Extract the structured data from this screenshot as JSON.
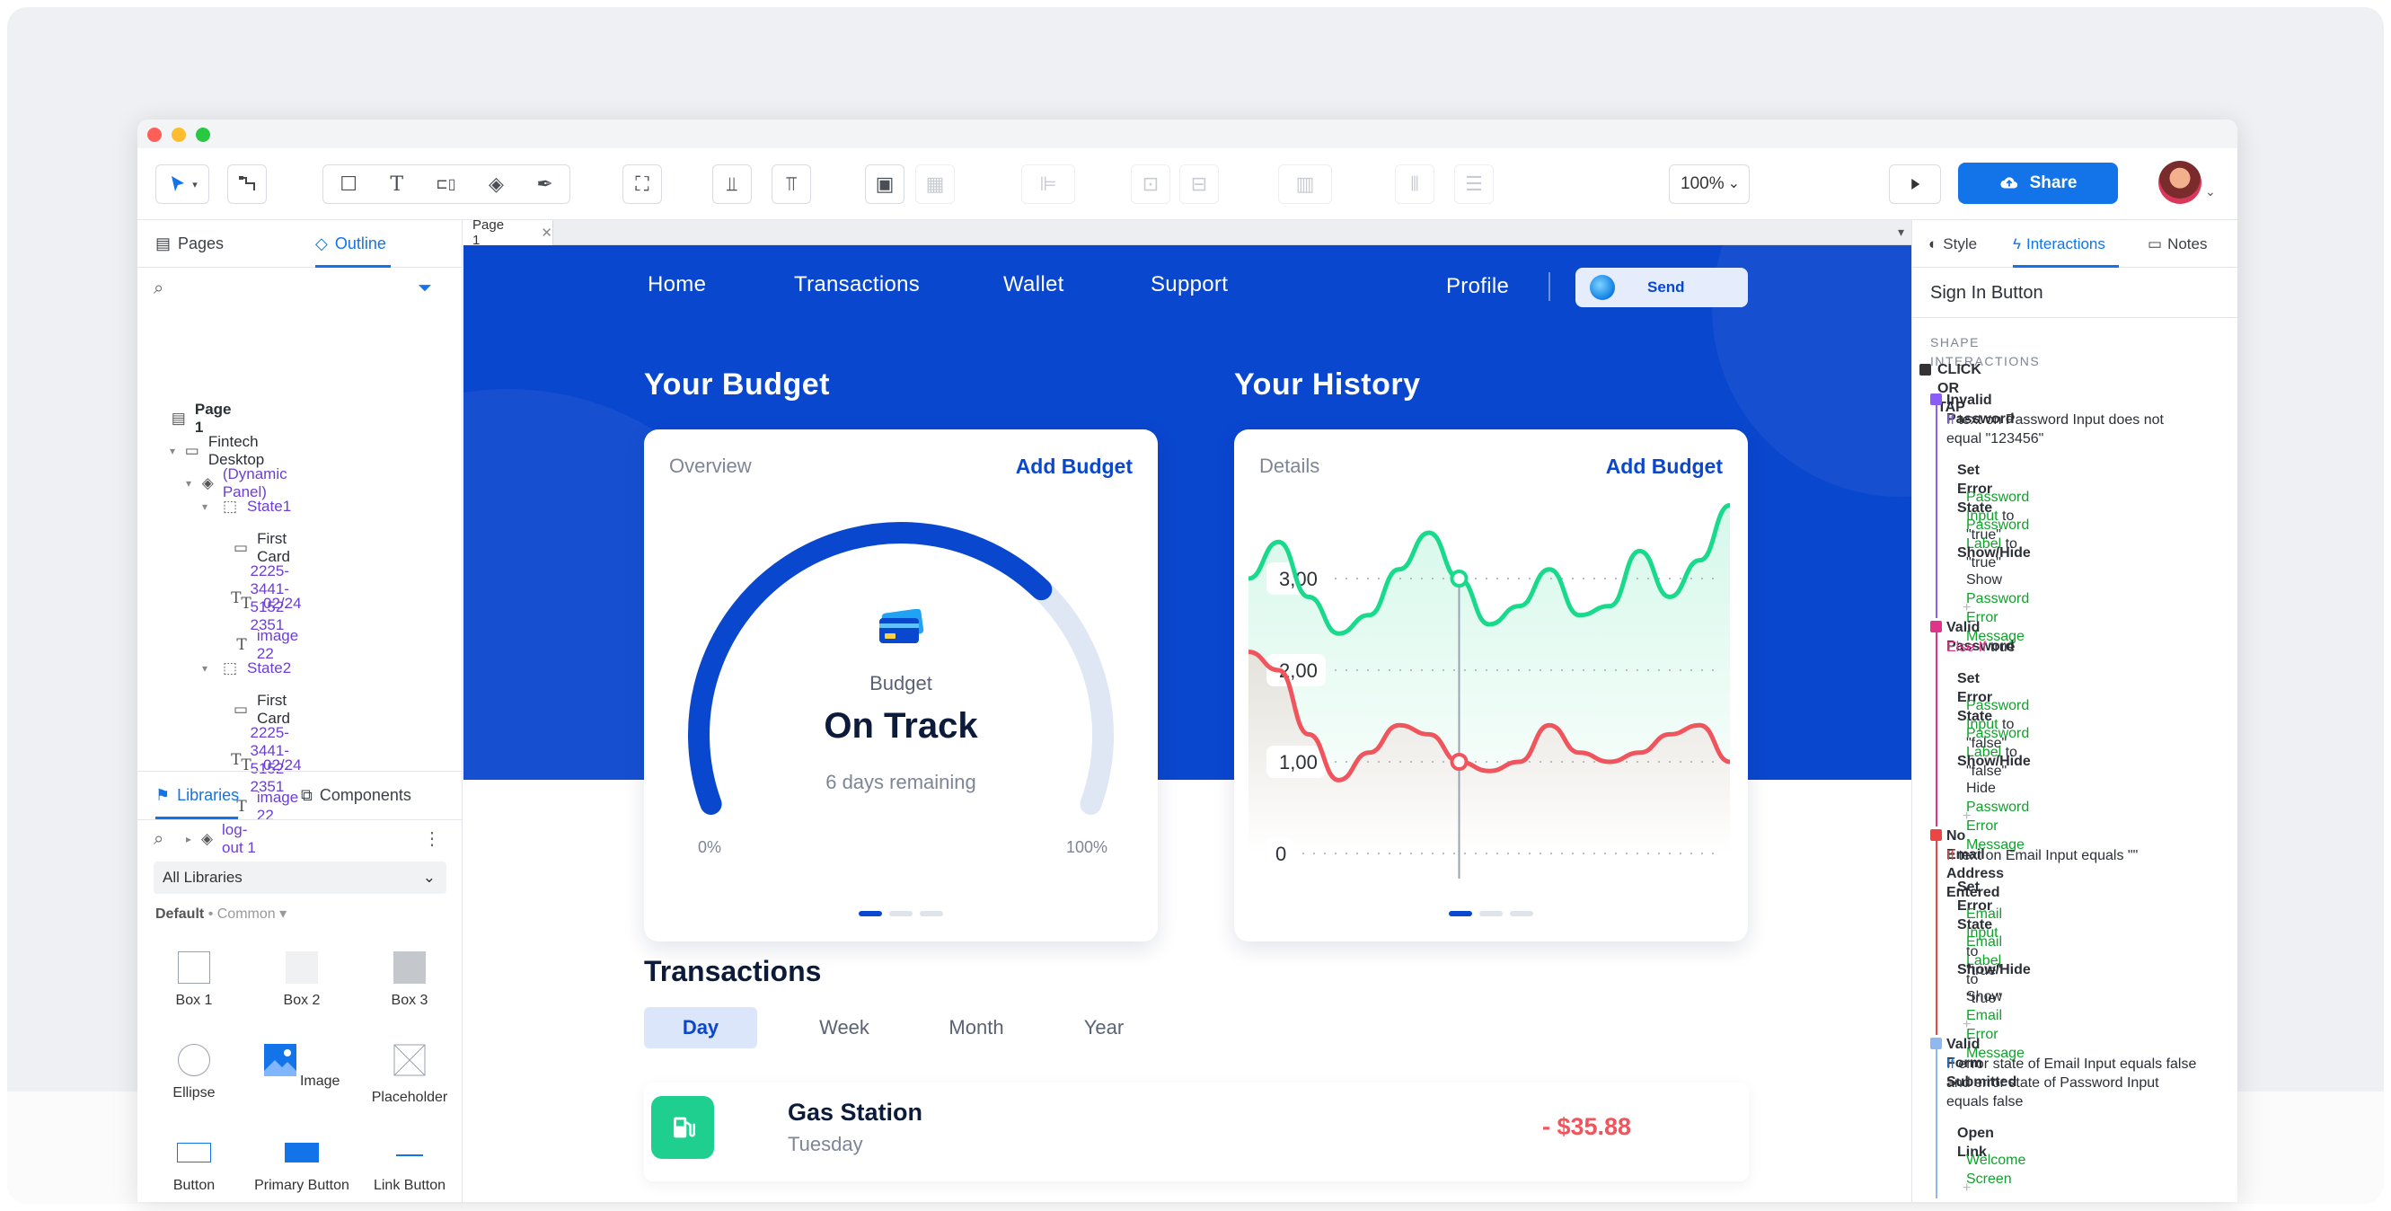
{
  "toolbar": {
    "zoom": "100%",
    "share_label": "Share"
  },
  "left_panel": {
    "tabs": [
      "Pages",
      "Outline"
    ],
    "tree": [
      {
        "label": "Page 1",
        "level": 0,
        "icon": "page-icon"
      },
      {
        "label": "Fintech Desktop",
        "level": 1,
        "icon": "folder-icon"
      },
      {
        "label": "(Dynamic Panel)",
        "level": 2,
        "icon": "layers-icon"
      },
      {
        "label": "State1",
        "level": 3,
        "icon": "state-icon"
      },
      {
        "label": "First Card",
        "level": 4,
        "icon": "rectangle-icon"
      },
      {
        "label": "2225-3441-5152-2351",
        "level": 4,
        "icon": "text-icon"
      },
      {
        "label": "02/24",
        "level": 4,
        "icon": "text-icon"
      },
      {
        "label": "image 22",
        "level": 4,
        "icon": "text-icon"
      },
      {
        "label": "State2",
        "level": 3,
        "icon": "state-icon"
      },
      {
        "label": "First Card",
        "level": 4,
        "icon": "rectangle-icon"
      },
      {
        "label": "2225-3441-5152-2351",
        "level": 4,
        "icon": "text-icon"
      },
      {
        "label": "02/24",
        "level": 4,
        "icon": "text-icon"
      },
      {
        "label": "image 22",
        "level": 4,
        "icon": "text-icon"
      },
      {
        "label": "log-out 1",
        "level": 2,
        "icon": "layers-icon"
      }
    ],
    "library_tabs": [
      "Libraries",
      "Components"
    ],
    "library_select": "All Libraries",
    "default_label": "Default",
    "common_label": "Common",
    "shapes": [
      "Box 1",
      "Box 2",
      "Box 3",
      "Ellipse",
      "Image",
      "Placeholder",
      "Button",
      "Primary Button",
      "Link Button"
    ]
  },
  "canvas": {
    "page_tab": "Page 1",
    "nav": [
      "Home",
      "Transactions",
      "Wallet",
      "Support",
      "Profile"
    ],
    "send_label": "Send",
    "budget": {
      "title": "Your Budget",
      "label": "Overview",
      "action": "Add Budget",
      "caption": "Budget",
      "status": "On Track",
      "remaining": "6 days remaining",
      "min": "0%",
      "max": "100%"
    },
    "history": {
      "title": "Your History",
      "label": "Details",
      "action": "Add Budget"
    },
    "transactions": {
      "title": "Transactions",
      "tabs": [
        "Day",
        "Week",
        "Month",
        "Year"
      ],
      "row": {
        "name": "Gas Station",
        "day": "Tuesday",
        "amount": "- $35.88"
      }
    }
  },
  "chart_data": [
    {
      "type": "gauge",
      "value": 0.7,
      "range_labels": [
        "0%",
        "100%"
      ]
    },
    {
      "type": "line",
      "yticks": [
        "0",
        "1,00",
        "2,00",
        "3,00"
      ],
      "ylim": [
        0,
        3.5
      ],
      "series": [
        {
          "color": "#19d98b",
          "values": [
            3.0,
            3.4,
            2.8,
            2.4,
            2.6,
            3.1,
            3.5,
            3.0,
            2.5,
            2.7,
            3.1,
            2.6,
            2.7,
            3.3,
            2.8,
            3.2,
            3.8
          ]
        },
        {
          "color": "#f0555d",
          "values": [
            2.2,
            2.0,
            1.3,
            0.8,
            1.1,
            1.4,
            1.3,
            1.0,
            0.9,
            1.0,
            1.4,
            1.1,
            1.0,
            1.1,
            1.3,
            1.4,
            1.0
          ]
        }
      ],
      "marker_index": 7
    }
  ],
  "right_panel": {
    "tabs": [
      "Style",
      "Interactions",
      "Notes"
    ],
    "selected": "Sign In Button",
    "section": "SHAPE INTERACTIONS",
    "event": "CLICK OR TAP",
    "cases": [
      {
        "name": "Invalid Password",
        "cond_kw": "If",
        "cond": "text on Password Input does not equal \"123456\"",
        "cond2": "equal \"123456\"",
        "color": "#8b5cf6",
        "actions": [
          {
            "type": "Set Error State",
            "lines": [
              [
                "Password Input",
                " to \"true\""
              ],
              [
                "Password Label",
                " to \"true\""
              ]
            ]
          },
          {
            "type": "Show/Hide",
            "lines": [
              [
                "Show ",
                "Password Error Message"
              ]
            ]
          }
        ]
      },
      {
        "name": "Valid Password",
        "cond_kw": "Else If",
        "cond": "true",
        "color": "#e0338a",
        "actions": [
          {
            "type": "Set Error State",
            "lines": [
              [
                "Password Input",
                " to \"false\""
              ],
              [
                "Password Label",
                " to \"false\""
              ]
            ]
          },
          {
            "type": "Show/Hide",
            "lines": [
              [
                "Hide ",
                "Password Error Message"
              ]
            ]
          }
        ]
      },
      {
        "name": "No Email Address Entered",
        "cond_kw": "If",
        "cond": "text on Email Input equals \"\"",
        "color": "#ef4444",
        "actions": [
          {
            "type": "Set Error State",
            "lines": [
              [
                "Email Input",
                " to \"true\""
              ],
              [
                "Email Label",
                " to \"true\""
              ]
            ]
          },
          {
            "type": "Show/Hide",
            "lines": [
              [
                "Show ",
                "Email Error Message"
              ]
            ]
          }
        ]
      },
      {
        "name": "Valid Form Submitted",
        "cond_kw": "If",
        "cond": "error state of Email Input equals false and error state of Password Input equals false",
        "color": "#8fb8f0",
        "actions": [
          {
            "type": "Open Link",
            "lines": [
              [
                "",
                "Welcome Screen"
              ]
            ]
          }
        ]
      }
    ]
  }
}
